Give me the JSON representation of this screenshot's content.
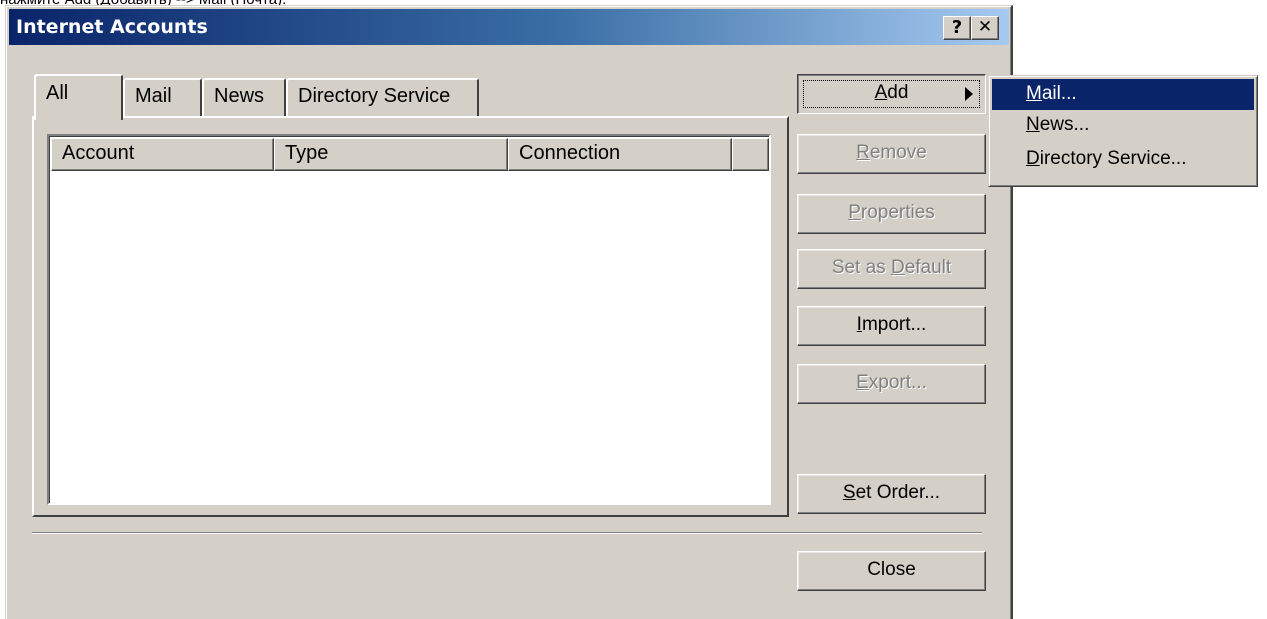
{
  "caption": "нажмите Add (Добавить) --> Mail (Почта).",
  "window": {
    "title": "Internet Accounts",
    "help_glyph": "?",
    "close_glyph": "✕"
  },
  "tabs": [
    "All",
    "Mail",
    "News",
    "Directory Service"
  ],
  "columns": [
    "Account",
    "Type",
    "Connection"
  ],
  "buttons": {
    "add": {
      "u": "A",
      "rest": "dd"
    },
    "remove": {
      "u": "R",
      "rest": "emove"
    },
    "properties": {
      "u": "P",
      "rest": "roperties"
    },
    "set_default": {
      "pre": "Set as ",
      "u": "D",
      "rest": "efault"
    },
    "import": {
      "u": "I",
      "rest": "mport..."
    },
    "export": {
      "u": "E",
      "rest": "xport..."
    },
    "set_order": {
      "u": "S",
      "rest": "et Order..."
    },
    "close": "Close"
  },
  "add_menu": [
    {
      "u": "M",
      "rest": "ail..."
    },
    {
      "u": "N",
      "rest": "ews..."
    },
    {
      "u": "D",
      "rest": "irectory Service..."
    }
  ]
}
